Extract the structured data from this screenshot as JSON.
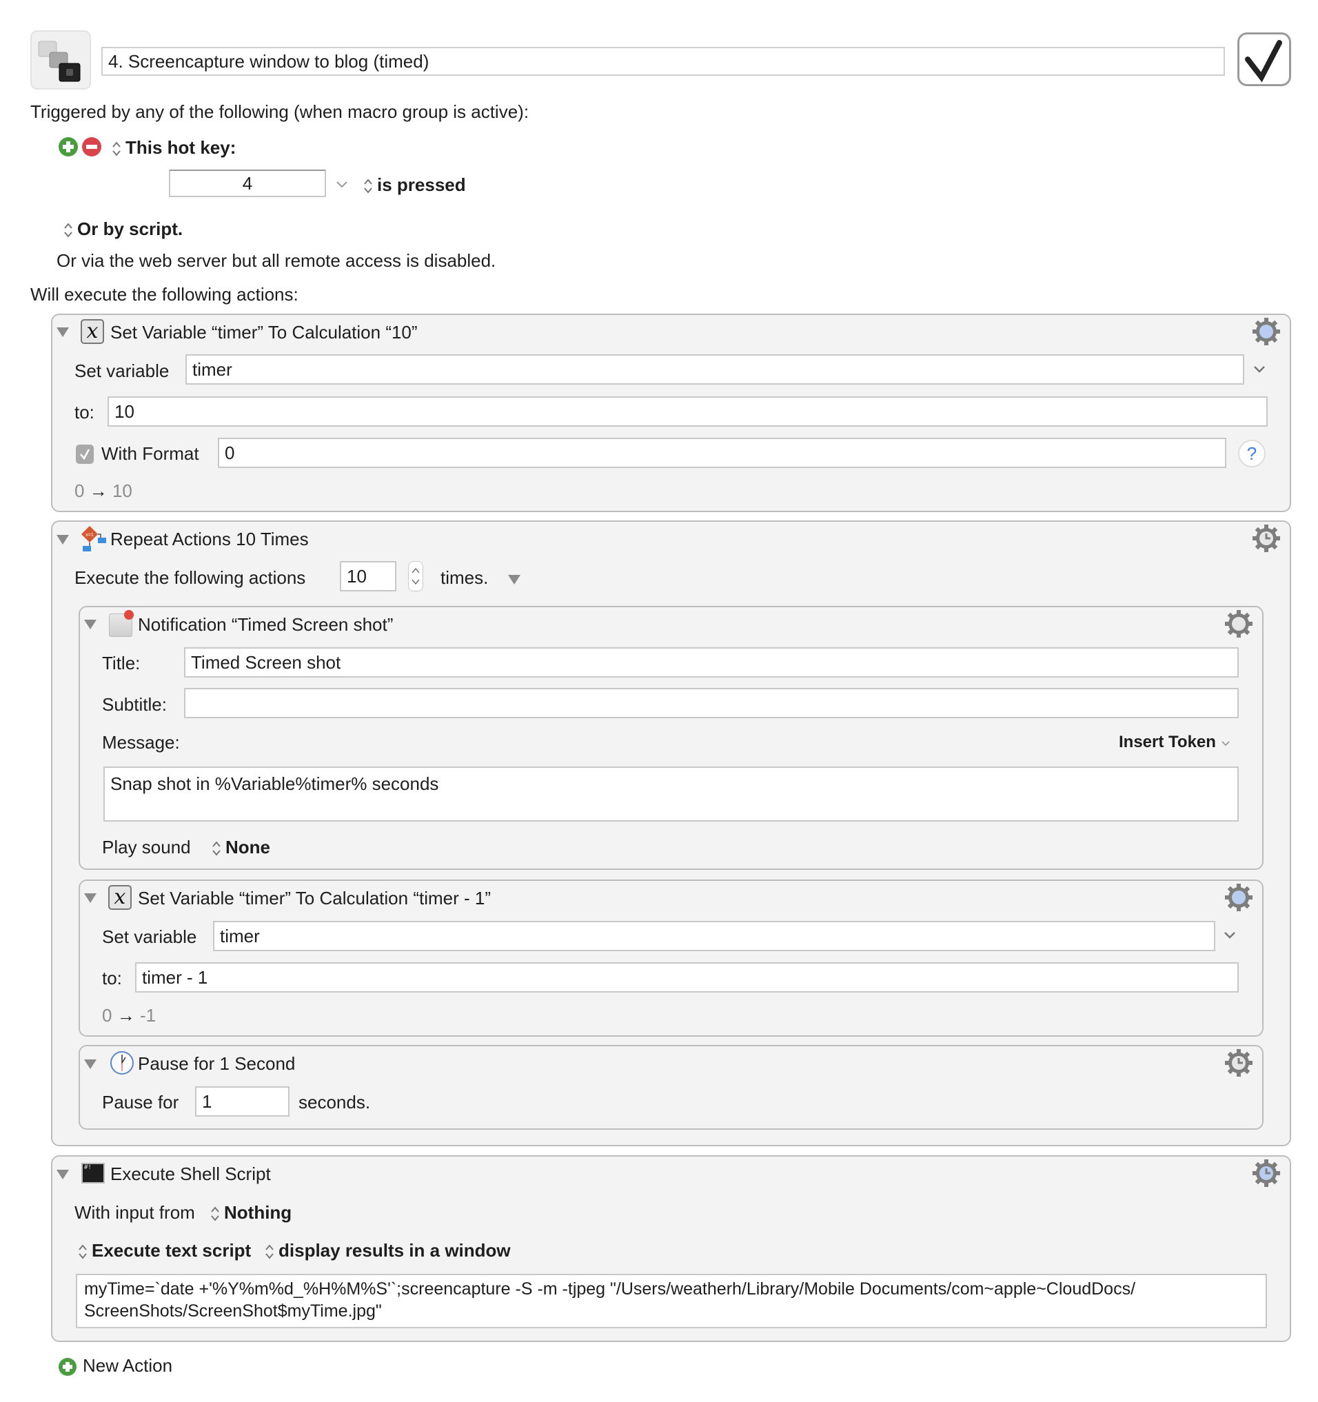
{
  "macro": {
    "name": "4. Screencapture window to blog (timed)",
    "enabled": true,
    "icon": "keyboard-keys-icon"
  },
  "triggers": {
    "heading": "Triggered by any of the following (when macro group is active):",
    "hotkey_label": "This hot key:",
    "hotkey_value": "4",
    "hotkey_condition": "is pressed",
    "or_script": "Or by script.",
    "web_server_note": "Or via the web server but all remote access is disabled."
  },
  "actions_heading": "Will execute the following actions:",
  "actions": {
    "set_var_1": {
      "title": "Set Variable “timer” To Calculation “10”",
      "set_variable_label": "Set variable",
      "variable": "timer",
      "to_label": "to:",
      "to_value": "10",
      "with_format_label": "With Format",
      "with_format_checked": true,
      "format_value": "0",
      "preview_from": "0",
      "preview_arrow": "→",
      "preview_to": "10",
      "help": "?"
    },
    "repeat": {
      "title": "Repeat Actions 10 Times",
      "execute_label": "Execute the following actions",
      "count": "10",
      "times_label": "times.",
      "notification": {
        "title": "Notification “Timed Screen shot”",
        "title_label": "Title:",
        "title_value": "Timed Screen shot",
        "subtitle_label": "Subtitle:",
        "subtitle_value": "",
        "message_label": "Message:",
        "insert_token": "Insert Token",
        "message_value": "Snap shot in %Variable%timer% seconds",
        "play_sound_label": "Play sound",
        "play_sound_value": "None"
      },
      "set_var_2": {
        "title": "Set Variable “timer” To Calculation “timer - 1”",
        "set_variable_label": "Set variable",
        "variable": "timer",
        "to_label": "to:",
        "to_value": "timer - 1",
        "preview_from": "0",
        "preview_arrow": "→",
        "preview_to": "-1"
      },
      "pause": {
        "title": "Pause for 1 Second",
        "pause_label": "Pause for",
        "value": "1",
        "unit_label": "seconds."
      }
    },
    "shell": {
      "title": "Execute Shell Script",
      "input_label": "With input from",
      "input_value": "Nothing",
      "mode_value": "Execute text script",
      "output_value": "display results in a window",
      "script_line1": "myTime=`date +'%Y%m%d_%H%M%S'`;screencapture -S -m -tjpeg \"/Users/weatherh/Library/Mobile Documents/com~apple~CloudDocs/",
      "script_line2": "ScreenShots/ScreenShot$myTime.jpg\""
    }
  },
  "new_action_label": "New Action",
  "colors": {
    "add_green": "#4a9d3f",
    "remove_red": "#d9434b",
    "gear_blue_center": "#b9cdf0",
    "help_blue": "#3b82f0",
    "box_bg": "#f3f3f3",
    "box_border": "#bdbdbd"
  }
}
